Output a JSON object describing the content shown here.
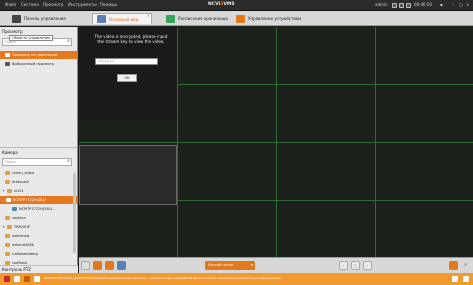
{
  "menu": {
    "items": [
      "Файл",
      "Система",
      "Просмотр",
      "Инструменты",
      "Помощь"
    ],
    "title_main": "NCVI",
    "title_accent": "3",
    "title_tail": "VMS",
    "user": "admin",
    "time": "08:46:50"
  },
  "tabs": [
    {
      "label": "Панель управления"
    },
    {
      "label": "Основной вид"
    },
    {
      "label": "Расписание хранилища"
    },
    {
      "label": "Управление устройством"
    }
  ],
  "left": {
    "view_header": "Просмотр",
    "view_search_placeholder": "Поиск",
    "tooltip": "Область управления",
    "view_items": [
      {
        "label": "Просмотр по умолчанию"
      },
      {
        "label": "Выборочный просмотр"
      }
    ],
    "camera_header": "Камера",
    "camera_search_placeholder": "Поиск",
    "camera_items": [
      {
        "label": "cheen_video"
      },
      {
        "label": "dreksuel2"
      },
      {
        "label": "ncl21"
      },
      {
        "label": "NCMTP1722H(281)"
      },
      {
        "label": "NCMTP1722H(281)..."
      },
      {
        "label": "cayface"
      },
      {
        "label": "TR620HP"
      },
      {
        "label": "extermals"
      },
      {
        "label": "wrkorld4586"
      },
      {
        "label": "rudianeenberg"
      },
      {
        "label": "rsoffrack"
      }
    ],
    "ptz_label": "Контроль PTZ"
  },
  "main": {
    "encrypted_msg": "The video is encrypted, please input the stream key to view the video.",
    "password_placeholder": "Stream key",
    "ok_label": "OK"
  },
  "toolbar": {
    "stream_label": "Легкий поток"
  },
  "status": {
    "text": "NCMTP1722H(281)_NCMTP1722H(281)[Тип]Ошибка подключения... Ошибка кода[ Loss](6BA7Bright1,b2,b4-b37 Ошибка(2-внешний код конфигурации)"
  },
  "colors": {
    "accent": "#e4791f",
    "status": "#f29a2f",
    "grid": "#2f6a38"
  }
}
